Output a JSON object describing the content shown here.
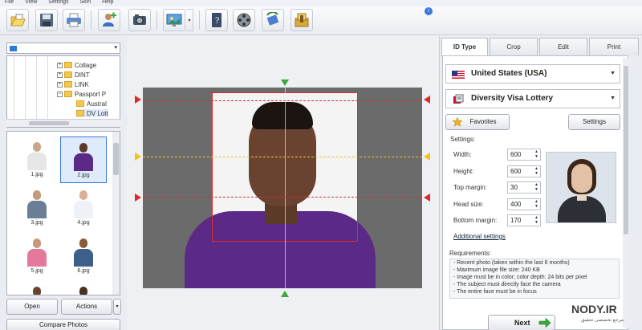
{
  "menu": [
    "File",
    "View",
    "Settings",
    "Skin",
    "Help"
  ],
  "toolbar": {
    "icons": [
      "open-folder-icon",
      "save-icon",
      "print-icon",
      "add-person-icon",
      "camera-icon",
      "monitor-icon",
      "info-book-icon",
      "film-reel-icon",
      "rotate-icon",
      "export-icon"
    ],
    "info_icon": "i"
  },
  "left": {
    "folder_dropdown_arrow": "▾",
    "tree": [
      {
        "label": "Collage",
        "expand": "+"
      },
      {
        "label": "DINT",
        "expand": "+"
      },
      {
        "label": "LINK",
        "expand": "+"
      },
      {
        "label": "Passport P",
        "expand": "−"
      },
      {
        "label": "Austral",
        "expand": ""
      },
      {
        "label": "DV Lott",
        "expand": ""
      }
    ],
    "thumbs": [
      {
        "name": "1.jpg",
        "shirt": "#e6e6e6",
        "skin": "#caa58a"
      },
      {
        "name": "2.jpg",
        "shirt": "#5a2a86",
        "skin": "#5b3a28"
      },
      {
        "name": "3.jpg",
        "shirt": "#6a7f96",
        "skin": "#c49a7c"
      },
      {
        "name": "4.jpg",
        "shirt": "#eef2f6",
        "skin": "#d8b09a"
      },
      {
        "name": "5.jpg",
        "shirt": "#e5799a",
        "skin": "#c9987b"
      },
      {
        "name": "6.jpg",
        "shirt": "#3e5f8a",
        "skin": "#8a5a3e"
      },
      {
        "name": "",
        "shirt": "#c0c0c0",
        "skin": "#6a4330"
      },
      {
        "name": "",
        "shirt": "#e8e8e8",
        "skin": "#4a3020"
      }
    ],
    "open_label": "Open",
    "actions_label": "Actions",
    "compare_label": "Compare Photos"
  },
  "tabs": [
    "ID Type",
    "Crop",
    "Edit",
    "Print"
  ],
  "right": {
    "country": "United States (USA)",
    "document": "Diversity Visa Lottery",
    "favorites_label": "Favorites",
    "settings_button_label": "Settings",
    "settings_header": "Settings:",
    "fields": [
      {
        "label": "Width:",
        "value": "600"
      },
      {
        "label": "Height:",
        "value": "600"
      },
      {
        "label": "Top margin:",
        "value": "30"
      },
      {
        "label": "Head size:",
        "value": "400"
      },
      {
        "label": "Bottom margin:",
        "value": "170"
      }
    ],
    "additional_settings": "Additional settings",
    "requirements_title": "Requirements:",
    "requirements": [
      "- Recent photo (taken within the last 6 months)",
      "- Maximum image file size: 240 KB",
      "- Image must be in color; color depth: 24 bits per pixel",
      "- The subject must directly face the camera",
      "- The entire face must be in focus"
    ],
    "next_label": "Next"
  },
  "watermark": {
    "text": "NODY.IR",
    "sub": "مرجع تخصصی تحقیق"
  },
  "colors": {
    "accent": "#3a7ad6",
    "guide_red": "#e02a2a",
    "guide_yellow": "#f0c419",
    "marker_green": "#3aa83a"
  }
}
